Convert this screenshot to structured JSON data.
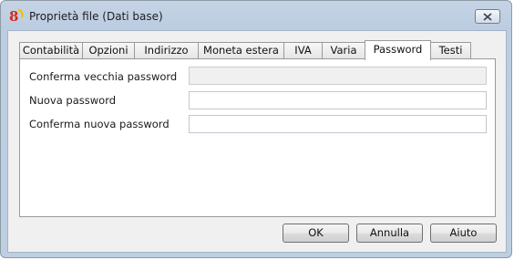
{
  "window": {
    "title": "Proprietà file (Dati base)"
  },
  "tabs": [
    {
      "label": "Contabilità",
      "active": false
    },
    {
      "label": "Opzioni",
      "active": false
    },
    {
      "label": "Indirizzo",
      "active": false
    },
    {
      "label": "Moneta estera",
      "active": false
    },
    {
      "label": "IVA",
      "active": false
    },
    {
      "label": "Varia",
      "active": false
    },
    {
      "label": "Password",
      "active": true
    },
    {
      "label": "Testi",
      "active": false
    }
  ],
  "form": {
    "old_password": {
      "label": "Conferma vecchia password",
      "value": "",
      "disabled": true
    },
    "new_password": {
      "label": "Nuova password",
      "value": ""
    },
    "confirm_new_password": {
      "label": "Conferma nuova password",
      "value": ""
    }
  },
  "buttons": {
    "ok": "OK",
    "cancel": "Annulla",
    "help": "Aiuto"
  },
  "icons": {
    "app": "banana-app-icon",
    "close": "close-icon"
  },
  "colors": {
    "accent_red": "#d42a1f",
    "accent_yellow": "#f2c200"
  }
}
